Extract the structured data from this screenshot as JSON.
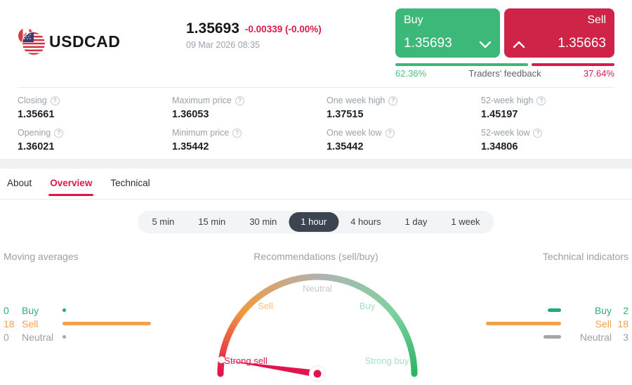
{
  "header": {
    "pair": "USDCAD",
    "price": "1.35693",
    "change": "-0.00339 (-0.00%)",
    "datetime": "09 Mar 2026 08:35",
    "buy": {
      "label": "Buy",
      "price": "1.35693"
    },
    "sell": {
      "label": "Sell",
      "price": "1.35663"
    },
    "feedback": {
      "buy_pct": "62.36%",
      "label": "Traders' feedback",
      "sell_pct": "37.64%"
    }
  },
  "ui": {
    "help_icon_glyph": "?"
  },
  "stats": [
    {
      "label": "Closing",
      "value": "1.35661"
    },
    {
      "label": "Maximum price",
      "value": "1.36053"
    },
    {
      "label": "One week high",
      "value": "1.37515"
    },
    {
      "label": "52-week high",
      "value": "1.45197"
    },
    {
      "label": "Opening",
      "value": "1.36021"
    },
    {
      "label": "Minimum price",
      "value": "1.35442"
    },
    {
      "label": "One week low",
      "value": "1.35442"
    },
    {
      "label": "52-week low",
      "value": "1.34806"
    }
  ],
  "tabs": [
    {
      "label": "About",
      "active": false
    },
    {
      "label": "Overview",
      "active": true
    },
    {
      "label": "Technical",
      "active": false
    }
  ],
  "timeframes": [
    {
      "label": "5 min",
      "active": false
    },
    {
      "label": "15 min",
      "active": false
    },
    {
      "label": "30 min",
      "active": false
    },
    {
      "label": "1 hour",
      "active": true
    },
    {
      "label": "4 hours",
      "active": false
    },
    {
      "label": "1 day",
      "active": false
    },
    {
      "label": "1 week",
      "active": false
    }
  ],
  "colors": {
    "buy_green": "#3cb878",
    "sell_red": "#cf2448",
    "change_red": "#d81b4a",
    "accent_red": "#e0164a",
    "bar_green": "#1cab7c",
    "bar_orange": "#f0a14c",
    "bar_gray": "#a6a6a6"
  },
  "chart_data": [
    {
      "type": "bar",
      "title": "Moving averages",
      "categories": [
        "Buy",
        "Sell",
        "Neutral"
      ],
      "values": [
        0,
        18,
        0
      ],
      "bar_colors": [
        "#1cab7c",
        "#f0a14c",
        "#a6a6a6"
      ],
      "legend_position": "left"
    },
    {
      "type": "gauge",
      "title": "Recommendations (sell/buy)",
      "labels": [
        "Strong sell",
        "Sell",
        "Neutral",
        "Buy",
        "Strong buy"
      ],
      "reading": "Strong sell",
      "needle_t": 0.046,
      "needle_color": "#e3134d",
      "color_stops": [
        {
          "t": 0,
          "color": "#e3134d"
        },
        {
          "t": 0.22,
          "color": "#ef9a3d"
        },
        {
          "t": 0.5,
          "color": "#b2b2b2"
        },
        {
          "t": 0.78,
          "color": "#7fd1a0"
        },
        {
          "t": 1,
          "color": "#2ab565"
        }
      ]
    },
    {
      "type": "bar",
      "title": "Technical indicators",
      "categories": [
        "Buy",
        "Sell",
        "Neutral"
      ],
      "values": [
        2,
        18,
        3
      ],
      "bar_colors": [
        "#1cab7c",
        "#f0a14c",
        "#a6a6a6"
      ],
      "legend_position": "right"
    }
  ]
}
